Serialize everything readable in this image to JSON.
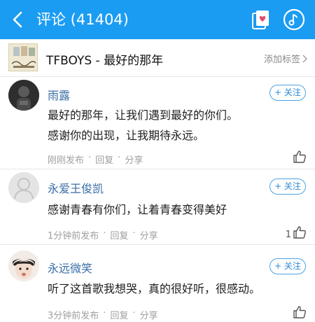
{
  "header": {
    "title": "评论 (41404)",
    "bg_color": "#1b9cf3",
    "icons": [
      "back-icon",
      "card-icon",
      "music-icon"
    ]
  },
  "song": {
    "title": "TFBOYS - 最好的那年",
    "tag_label": "添加标签",
    "cover_icon": "album-cover"
  },
  "comments": [
    {
      "user": "雨露",
      "follow_label": "+ 关注",
      "lines": [
        "最好的那年，让我们遇到最好的你们。",
        "感谢你的出现，让我期待永远。"
      ],
      "time": "刚刚发布",
      "sep1": "·",
      "reply": "回复",
      "sep2": "·",
      "share": "分享",
      "likes": ""
    },
    {
      "user": "永爱王俊凯",
      "follow_label": "+ 关注",
      "lines": [
        "感谢青春有你们，让着青春变得美好"
      ],
      "time": "1分钟前发布",
      "sep1": "·",
      "reply": "回复",
      "sep2": "·",
      "share": "分享",
      "likes": "1"
    },
    {
      "user": "永远微笑",
      "follow_label": "+ 关注",
      "lines": [
        "听了这首歌我想哭，真的很好听，很感动。"
      ],
      "time": "3分钟前发布",
      "sep1": "·",
      "reply": "回复",
      "sep2": "·",
      "share": "分享",
      "likes": ""
    }
  ]
}
